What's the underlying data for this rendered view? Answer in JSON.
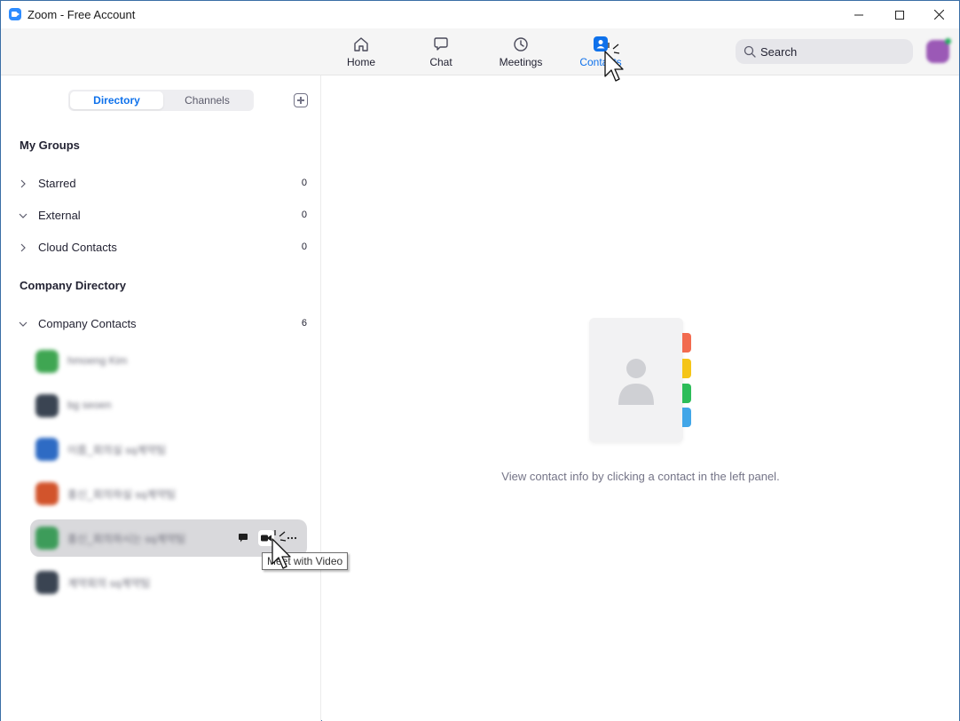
{
  "window": {
    "title": "Zoom - Free Account",
    "controls": [
      "minimize",
      "maximize",
      "close"
    ]
  },
  "topnav": {
    "items": [
      {
        "label": "Home",
        "icon": "home-icon",
        "active": false
      },
      {
        "label": "Chat",
        "icon": "chat-icon",
        "active": false
      },
      {
        "label": "Meetings",
        "icon": "clock-icon",
        "active": false
      },
      {
        "label": "Contacts",
        "icon": "contacts-icon",
        "active": true
      }
    ],
    "search_placeholder": "Search"
  },
  "sidebar": {
    "tabs": {
      "directory": "Directory",
      "channels": "Channels"
    },
    "my_groups_title": "My Groups",
    "my_groups": [
      {
        "label": "Starred",
        "count": "0",
        "expanded": false
      },
      {
        "label": "External",
        "count": "0",
        "expanded": true
      },
      {
        "label": "Cloud Contacts",
        "count": "0",
        "expanded": false
      }
    ],
    "company_directory_title": "Company Directory",
    "company_contacts": {
      "label": "Company Contacts",
      "count": "6",
      "expanded": true
    },
    "contacts": [
      {
        "name": "hmoeng Kim",
        "avatar_color": "#3fa652"
      },
      {
        "name": "bg seoen",
        "avatar_color": "#3a4452"
      },
      {
        "name": "이름_회의실 sq계약팀",
        "avatar_color": "#2e6bc4"
      },
      {
        "name": "홍신_회의하실 sq계약팀",
        "avatar_color": "#d2542c"
      },
      {
        "name": "홍신_회의하시는 sq계약팀",
        "avatar_color": "#3d9c5a"
      },
      {
        "name": "계약회의 sq계약팀",
        "avatar_color": "#3a4452"
      }
    ],
    "tooltip": "Meet with Video"
  },
  "main": {
    "empty_message": "View contact info by clicking a contact in the left panel.",
    "tab_colors": [
      "#f26b4f",
      "#f5c518",
      "#2dbd59",
      "#41a6e8"
    ]
  },
  "colors": {
    "accent": "#0E71EB",
    "brand": "#2D8CFF"
  }
}
